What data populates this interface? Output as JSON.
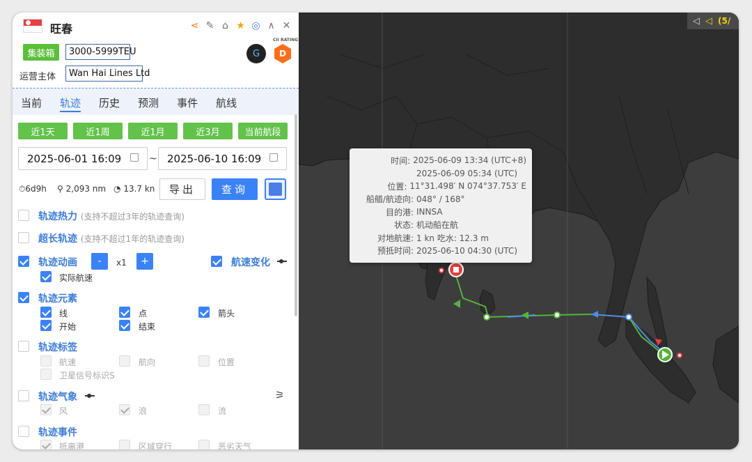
{
  "ship": {
    "name": "旺春",
    "flag": "Singapore",
    "type_tag": "集装箱",
    "teu_range": "3000-5999TEU",
    "operator_label": "运营主体",
    "operator": "Wan Hai Lines Ltd",
    "cii_label": "CII RATING",
    "cii_grade": "D",
    "logo_glyph": "G"
  },
  "header_icons": [
    "share-icon",
    "edit-icon",
    "tag-icon",
    "star-icon",
    "locate-icon",
    "collapse-icon",
    "close-icon"
  ],
  "icon_glyphs": {
    "share": "⋖",
    "edit": "✎",
    "tag": "⌂",
    "star": "★",
    "locate": "◎",
    "collapse": "∧",
    "close": "✕"
  },
  "tabs": [
    "当前",
    "轨迹",
    "历史",
    "预测",
    "事件",
    "航线"
  ],
  "active_tab": "轨迹",
  "quick_ranges": [
    "近1天",
    "近1周",
    "近1月",
    "近3月",
    "当前航段"
  ],
  "date_from": "2025-06-01 16:09",
  "date_sep": "~",
  "date_to": "2025-06-10 16:09",
  "stats": {
    "duration": "6d9h",
    "distance": "2,093 nm",
    "avg_speed": "13.7 kn",
    "duration_icon": "⏱",
    "distance_icon": "⚲",
    "speed_icon": "◔"
  },
  "buttons": {
    "export": "导出",
    "query": "查询"
  },
  "sections": {
    "heat": {
      "label": "轨迹热力",
      "note": "(支持不超过3年的轨迹查询)",
      "checked": false
    },
    "long": {
      "label": "超长轨迹",
      "note": "(支持不超过1年的轨迹查询)",
      "checked": false
    },
    "anim": {
      "label": "轨迹动画",
      "checked": true,
      "minus": "-",
      "speed": "x1",
      "plus": "+",
      "real_speed": "实际航速"
    },
    "speed_change": {
      "label": "航速变化",
      "checked": true
    },
    "elements": {
      "label": "轨迹元素",
      "checked": true,
      "items": [
        "线",
        "点",
        "箭头",
        "开始",
        "结束"
      ]
    },
    "labels": {
      "label": "轨迹标签",
      "checked": false,
      "items": [
        "航速",
        "航向",
        "位置",
        "卫星信号标识S"
      ]
    },
    "weather": {
      "label": "轨迹气象",
      "checked": false,
      "items": [
        "风",
        "浪",
        "流"
      ],
      "icon": "⚞"
    },
    "events": {
      "label": "轨迹事件",
      "checked": false,
      "items": [
        "抵离港",
        "区域穿行",
        "恶劣天气"
      ]
    }
  },
  "map_tools": {
    "back_icon": "◁",
    "speaker_icon": "◁",
    "page": "(5/"
  },
  "tooltip": {
    "rows": [
      {
        "k": "时间:",
        "v": "2025-06-09 13:34 (UTC+8)"
      },
      {
        "k": "",
        "v": "2025-06-09 05:34 (UTC)"
      },
      {
        "k": "位置:",
        "v": "11°31.498′ N  074°37.753′ E"
      },
      {
        "k": "船艏/航迹向:",
        "v": "048° / 168°"
      },
      {
        "k": "目的港:",
        "v": "INNSA"
      },
      {
        "k": "状态:",
        "v": "机动船在航"
      },
      {
        "k": "对地航速:",
        "v": "1 kn  吃水: 12.3 m"
      },
      {
        "k": "预抵时间:",
        "v": "2025-06-10 04:30 (UTC)"
      }
    ]
  },
  "colors": {
    "accent": "#3b82f6",
    "green_btn": "#62c24a",
    "track_green": "#57b33d",
    "track_blue": "#4a8fe7",
    "land": "#2f2f2f",
    "sea": "#3d3d3d"
  }
}
